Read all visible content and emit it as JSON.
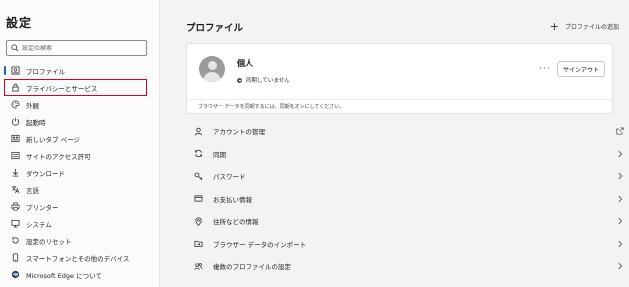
{
  "sidebar": {
    "title": "設定",
    "search_placeholder": "設定の検索",
    "items": [
      {
        "label": "プロファイル",
        "icon": "profile-icon"
      },
      {
        "label": "プライバシーとサービス",
        "icon": "lock-icon"
      },
      {
        "label": "外観",
        "icon": "palette-icon"
      },
      {
        "label": "起動時",
        "icon": "power-icon"
      },
      {
        "label": "新しいタブ ページ",
        "icon": "new-tab-icon"
      },
      {
        "label": "サイトのアクセス許可",
        "icon": "site-permissions-icon"
      },
      {
        "label": "ダウンロード",
        "icon": "download-icon"
      },
      {
        "label": "言語",
        "icon": "language-icon"
      },
      {
        "label": "プリンター",
        "icon": "printer-icon"
      },
      {
        "label": "システム",
        "icon": "system-icon"
      },
      {
        "label": "設定のリセット",
        "icon": "reset-icon"
      },
      {
        "label": "スマートフォンとその他のデバイス",
        "icon": "phone-icon"
      },
      {
        "label": "Microsoft Edge について",
        "icon": "edge-icon"
      }
    ]
  },
  "main": {
    "title": "プロファイル",
    "add_profile_label": "プロファイルの追加",
    "card": {
      "name": "個人",
      "sync_status": "同期していません",
      "more_label": "···",
      "signin_label": "サインアウト",
      "note": "ブラウザー データを同期するには、同期をオンにしてください。"
    },
    "rows": [
      {
        "label": "アカウントの管理",
        "icon": "person-icon",
        "trail": "external-link-icon"
      },
      {
        "label": "同期",
        "icon": "sync-icon",
        "trail": "chevron-right-icon"
      },
      {
        "label": "パスワード",
        "icon": "key-icon",
        "trail": "chevron-right-icon"
      },
      {
        "label": "お支払い情報",
        "icon": "card-icon",
        "trail": "chevron-right-icon"
      },
      {
        "label": "住所などの情報",
        "icon": "location-icon",
        "trail": "chevron-right-icon"
      },
      {
        "label": "ブラウザー データのインポート",
        "icon": "import-icon",
        "trail": "chevron-right-icon"
      },
      {
        "label": "複数のプロファイルの設定",
        "icon": "multi-profile-icon",
        "trail": "chevron-right-icon"
      }
    ]
  },
  "colors": {
    "accent": "#0f6cbd",
    "highlight_border": "#e0001b"
  }
}
